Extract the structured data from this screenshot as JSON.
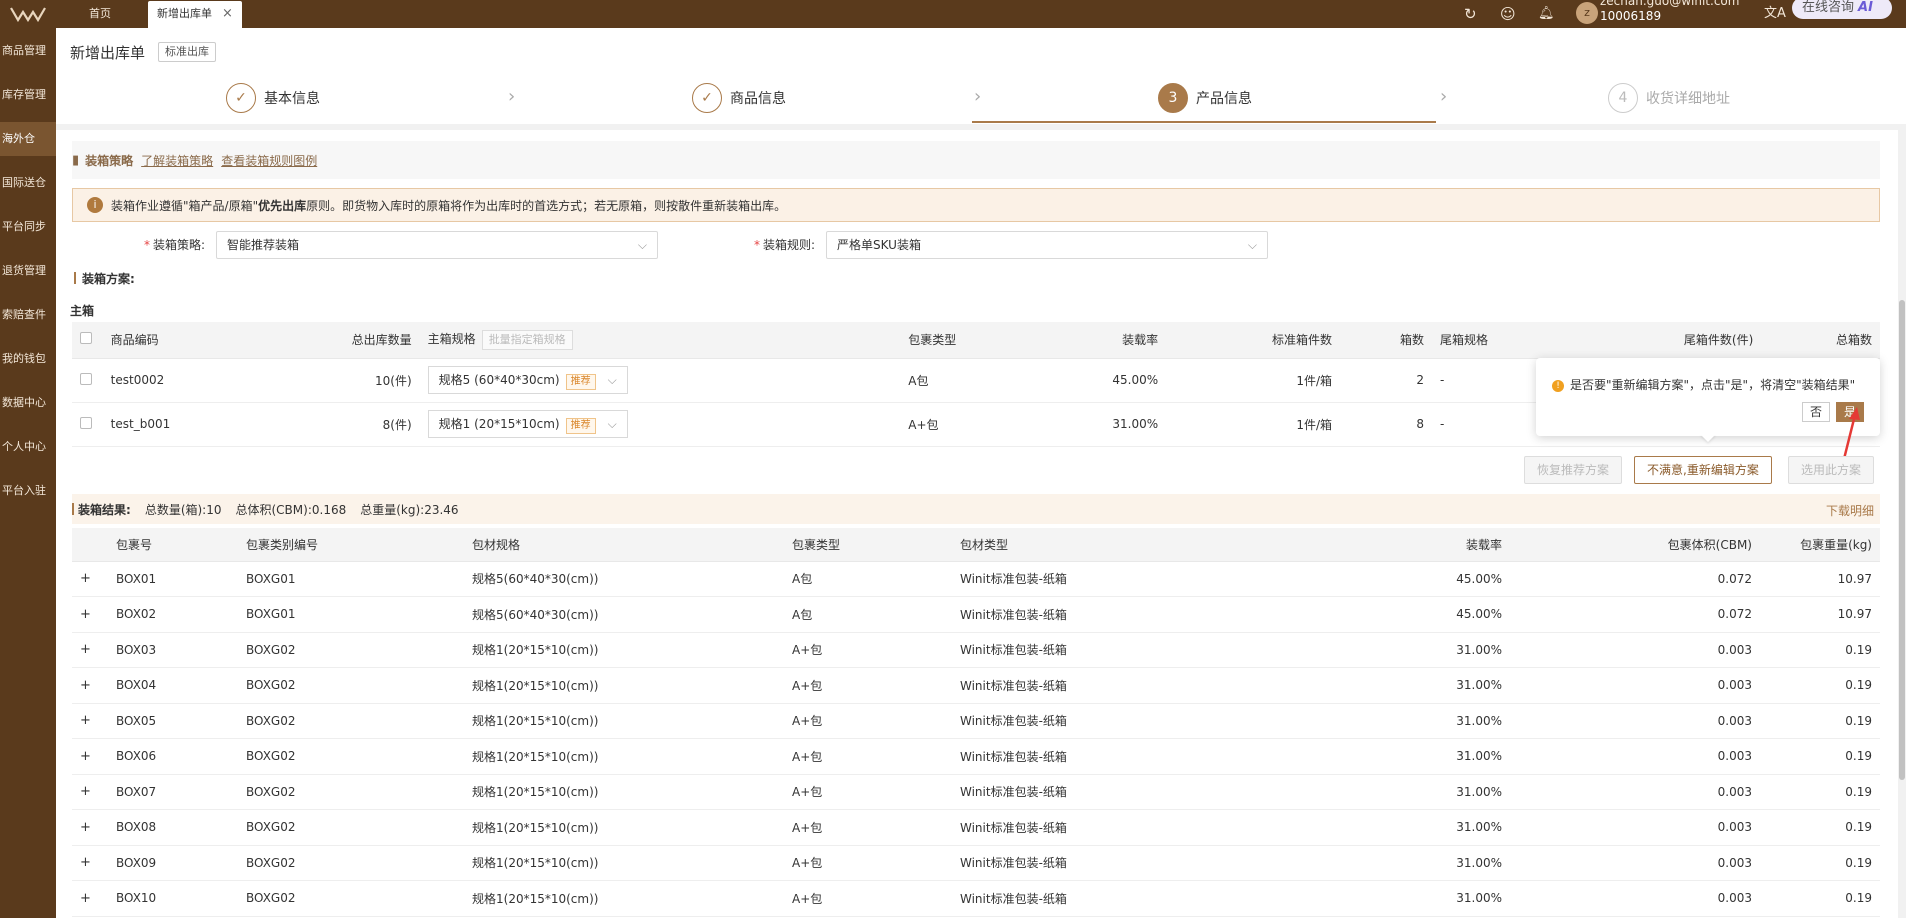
{
  "topbar": {
    "tabs": [
      {
        "label": "首页"
      },
      {
        "label": "新增出库单"
      }
    ],
    "user_avatar_letter": "z",
    "user_email": "zechan.guo@winit.com",
    "user_id": "10006189",
    "consult_label": "在线咨询",
    "consult_ai": "AI"
  },
  "sidebar": {
    "items": [
      {
        "label": "商品管理"
      },
      {
        "label": "库存管理"
      },
      {
        "label": "海外仓"
      },
      {
        "label": "国际送仓"
      },
      {
        "label": "平台同步"
      },
      {
        "label": "退货管理"
      },
      {
        "label": "索赔查件"
      },
      {
        "label": "我的钱包"
      },
      {
        "label": "数据中心"
      },
      {
        "label": "个人中心"
      },
      {
        "label": "平台入驻"
      }
    ]
  },
  "header": {
    "title": "新增出库单",
    "tag": "标准出库"
  },
  "steps": [
    {
      "label": "基本信息",
      "mark": "✓",
      "status": "done"
    },
    {
      "label": "商品信息",
      "mark": "✓",
      "status": "done"
    },
    {
      "label": "产品信息",
      "mark": "3",
      "status": "current"
    },
    {
      "label": "收货详细地址",
      "mark": "4",
      "status": "pending"
    }
  ],
  "packing_section": {
    "title": "装箱策略",
    "link_learn": "了解装箱策略",
    "link_examples": "查看装箱规则图例",
    "notice_prefix": "装箱作业遵循\"箱产品/原箱\"",
    "notice_bold": "优先出库",
    "notice_suffix": "原则。即货物入库时的原箱将作为出库时的首选方式；若无原箱，则按散件重新装箱出库。",
    "strategy_label": "装箱策略:",
    "strategy_value": "智能推荐装箱",
    "rule_label": "装箱规则:",
    "rule_value": "严格单SKU装箱",
    "plan_title": "装箱方案:",
    "main_box_label": "主箱"
  },
  "plan_table": {
    "headers": {
      "code": "商品编码",
      "total_qty": "总出库数量",
      "main_spec": "主箱规格",
      "batch_btn": "批量指定箱规格",
      "pkg_type": "包裹类型",
      "load_rate": "装载率",
      "std_pcs": "标准箱件数",
      "boxes": "箱数",
      "tail_spec": "尾箱规格",
      "tail_pcs": "尾箱件数(件)",
      "total_boxes": "总箱数"
    },
    "rows": [
      {
        "code": "test0002",
        "total_qty": "10(件)",
        "spec": "规格5 (60*40*30cm)",
        "rec": "推荐",
        "pkg_type": "A包",
        "load_rate": "45.00%",
        "std_pcs": "1件/箱",
        "boxes": "2",
        "tail_spec": "-"
      },
      {
        "code": "test_b001",
        "total_qty": "8(件)",
        "spec": "规格1 (20*15*10cm)",
        "rec": "推荐",
        "pkg_type": "A+包",
        "load_rate": "31.00%",
        "std_pcs": "1件/箱",
        "boxes": "8",
        "tail_spec": "-"
      }
    ]
  },
  "actions": {
    "restore": "恢复推荐方案",
    "reedit": "不满意,重新编辑方案",
    "use_plan": "选用此方案"
  },
  "popconfirm": {
    "message": "是否要\"重新编辑方案\"，点击\"是\"，将清空\"装箱结果\"",
    "no": "否",
    "yes": "是"
  },
  "result": {
    "title": "装箱结果:",
    "total_boxes": "总数量(箱):10",
    "total_volume": "总体积(CBM):0.168",
    "total_weight": "总重量(kg):23.46",
    "download": "下载明细",
    "headers": [
      "包裹号",
      "包裹类别编号",
      "包材规格",
      "包裹类型",
      "包材类型",
      "装载率",
      "包裹体积(CBM)",
      "包裹重量(kg)"
    ],
    "rows": [
      [
        "BOX01",
        "BOXG01",
        "规格5(60*40*30(cm))",
        "A包",
        "Winit标准包装-纸箱",
        "45.00%",
        "0.072",
        "10.97"
      ],
      [
        "BOX02",
        "BOXG01",
        "规格5(60*40*30(cm))",
        "A包",
        "Winit标准包装-纸箱",
        "45.00%",
        "0.072",
        "10.97"
      ],
      [
        "BOX03",
        "BOXG02",
        "规格1(20*15*10(cm))",
        "A+包",
        "Winit标准包装-纸箱",
        "31.00%",
        "0.003",
        "0.19"
      ],
      [
        "BOX04",
        "BOXG02",
        "规格1(20*15*10(cm))",
        "A+包",
        "Winit标准包装-纸箱",
        "31.00%",
        "0.003",
        "0.19"
      ],
      [
        "BOX05",
        "BOXG02",
        "规格1(20*15*10(cm))",
        "A+包",
        "Winit标准包装-纸箱",
        "31.00%",
        "0.003",
        "0.19"
      ],
      [
        "BOX06",
        "BOXG02",
        "规格1(20*15*10(cm))",
        "A+包",
        "Winit标准包装-纸箱",
        "31.00%",
        "0.003",
        "0.19"
      ],
      [
        "BOX07",
        "BOXG02",
        "规格1(20*15*10(cm))",
        "A+包",
        "Winit标准包装-纸箱",
        "31.00%",
        "0.003",
        "0.19"
      ],
      [
        "BOX08",
        "BOXG02",
        "规格1(20*15*10(cm))",
        "A+包",
        "Winit标准包装-纸箱",
        "31.00%",
        "0.003",
        "0.19"
      ],
      [
        "BOX09",
        "BOXG02",
        "规格1(20*15*10(cm))",
        "A+包",
        "Winit标准包装-纸箱",
        "31.00%",
        "0.003",
        "0.19"
      ],
      [
        "BOX10",
        "BOXG02",
        "规格1(20*15*10(cm))",
        "A+包",
        "Winit标准包装-纸箱",
        "31.00%",
        "0.003",
        "0.19"
      ]
    ]
  },
  "colors": {
    "brand_dark": "#5a3a1c",
    "accent": "#a97a4a",
    "warning": "#f0a020",
    "annotation_arrow": "#e53935"
  },
  "icons": [
    "logo-icon",
    "refresh-icon",
    "smile-icon",
    "bell-icon",
    "translate-icon",
    "book-icon",
    "info-icon",
    "warning-icon",
    "chevron-down-icon",
    "chevron-right-icon",
    "plus-icon"
  ]
}
